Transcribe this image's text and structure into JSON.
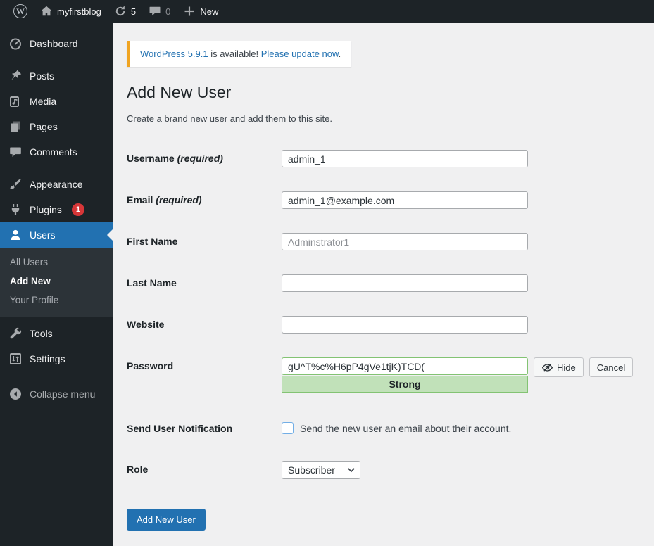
{
  "admin_bar": {
    "site_name": "myfirstblog",
    "updates_count": "5",
    "comments_count": "0",
    "new_label": "New"
  },
  "sidebar": {
    "items": [
      {
        "label": "Dashboard"
      },
      {
        "label": "Posts"
      },
      {
        "label": "Media"
      },
      {
        "label": "Pages"
      },
      {
        "label": "Comments"
      },
      {
        "label": "Appearance"
      },
      {
        "label": "Plugins",
        "badge": "1"
      },
      {
        "label": "Users"
      },
      {
        "label": "Tools"
      },
      {
        "label": "Settings"
      },
      {
        "label": "Collapse menu"
      }
    ],
    "users_submenu": [
      {
        "label": "All Users"
      },
      {
        "label": "Add New"
      },
      {
        "label": "Your Profile"
      }
    ]
  },
  "notice": {
    "link1": "WordPress 5.9.1",
    "middle": " is available! ",
    "link2": "Please update now",
    "suffix": "."
  },
  "page": {
    "title": "Add New User",
    "description": "Create a brand new user and add them to this site."
  },
  "form": {
    "username": {
      "label": "Username",
      "required": "(required)",
      "value": "admin_1"
    },
    "email": {
      "label": "Email",
      "required": "(required)",
      "value": "admin_1@example.com"
    },
    "first_name": {
      "label": "First Name",
      "value": "Adminstrator1"
    },
    "last_name": {
      "label": "Last Name",
      "value": ""
    },
    "website": {
      "label": "Website",
      "value": ""
    },
    "password": {
      "label": "Password",
      "value": "gU^T%c%H6pP4gVe1tjK)TCD(",
      "hide_label": "Hide",
      "cancel_label": "Cancel",
      "strength": "Strong"
    },
    "notification": {
      "label": "Send User Notification",
      "checkbox_label": "Send the new user an email about their account."
    },
    "role": {
      "label": "Role",
      "value": "Subscriber"
    },
    "submit_label": "Add New User"
  },
  "colors": {
    "accent": "#2271b1",
    "admin_bar_bg": "#1d2327",
    "content_bg": "#f0f0f1",
    "warning_border": "#f0a422",
    "badge_red": "#d63638",
    "strength_strong_bg": "#c1e1b9",
    "strength_strong_border": "#83c373"
  }
}
